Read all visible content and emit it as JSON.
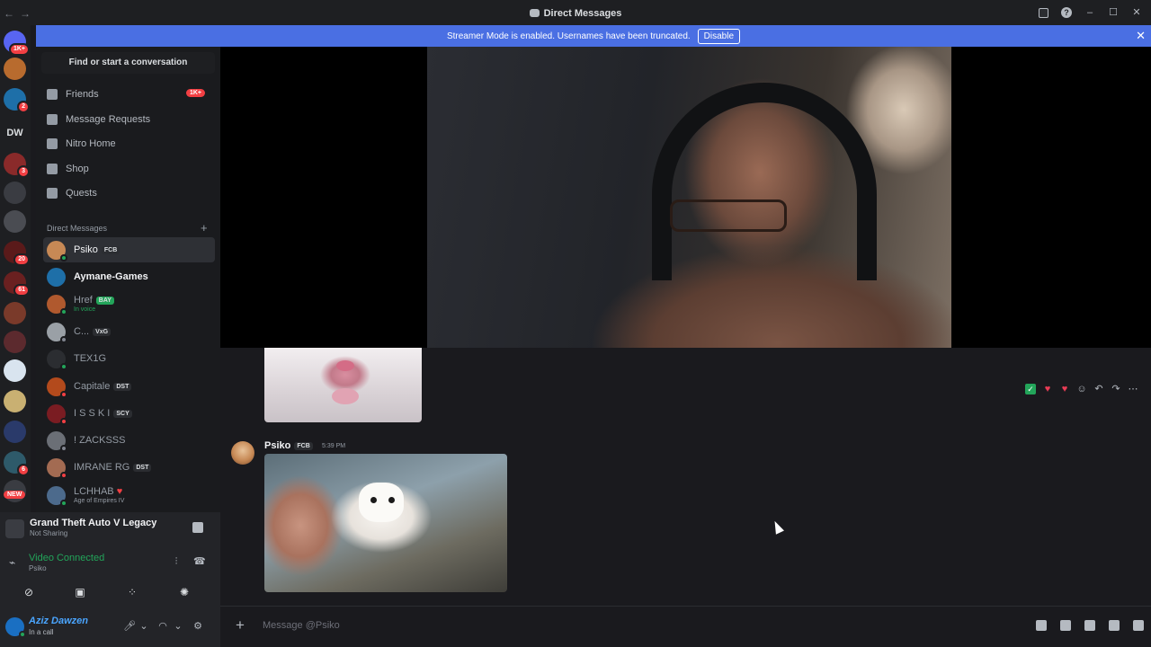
{
  "titlebar": {
    "title": "Direct Messages",
    "back": "←",
    "forward": "→"
  },
  "banner": {
    "text": "Streamer Mode is enabled. Usernames have been truncated.",
    "button": "Disable",
    "close": "✕"
  },
  "guilds": {
    "top_badge": "1K+",
    "badges": [
      "2",
      "3",
      "20",
      "61",
      "6"
    ],
    "dw_label": "DW",
    "new_label": "NEW"
  },
  "sidebar": {
    "search": "Find or start a conversation",
    "nav": [
      {
        "label": "Friends",
        "badge": "1K+",
        "icon": "friends-icon"
      },
      {
        "label": "Message Requests",
        "icon": "envelope-icon"
      },
      {
        "label": "Nitro Home",
        "icon": "nitro-icon"
      },
      {
        "label": "Shop",
        "icon": "shop-icon"
      },
      {
        "label": "Quests",
        "icon": "quests-icon"
      }
    ],
    "dm_header": "Direct Messages",
    "dm_header_add": "+",
    "dms": [
      {
        "name": "Psiko",
        "tag": "FCB",
        "sub": "",
        "color": "#c78955"
      },
      {
        "name": "Aymane-Games",
        "tag": "",
        "sub": "",
        "color": "#1e6fa8"
      },
      {
        "name": "Href",
        "tag": "BAY",
        "sub": "In voice",
        "color": "#b0592e"
      },
      {
        "name": "C...",
        "tag": "VxG",
        "sub": "",
        "color": "#9aa0a6"
      },
      {
        "name": "TEX1G",
        "tag": "",
        "sub": "",
        "color": "#2b2d31"
      },
      {
        "name": "Capitale",
        "tag": "DST",
        "sub": "",
        "color": "#b34a1c"
      },
      {
        "name": "I S S K I",
        "tag": "SCY",
        "sub": "",
        "color": "#7a1c22"
      },
      {
        "name": "! ZACKSSS",
        "tag": "",
        "sub": "",
        "color": "#6b6f76"
      },
      {
        "name": "IMRANE RG",
        "tag": "DST",
        "sub": "",
        "color": "#a36b52"
      },
      {
        "name": "LCHHAB",
        "tag": "",
        "sub": "Age of Empires IV",
        "color": "#4c6a8c"
      }
    ]
  },
  "activity": {
    "title": "Grand Theft Auto V Legacy",
    "sub": "Not Sharing"
  },
  "voice": {
    "status": "Video Connected",
    "channel": "Psiko"
  },
  "user": {
    "name": "Aziz Dawzen",
    "status": "In a call"
  },
  "message": {
    "author": "Psiko",
    "tag": "FCB",
    "time": "5:39 PM"
  },
  "composer": {
    "placeholder": "Message @Psiko",
    "plus": "+"
  },
  "colors": {
    "accent": "#4a6fe3",
    "online": "#23a55a",
    "danger": "#f23f43"
  }
}
